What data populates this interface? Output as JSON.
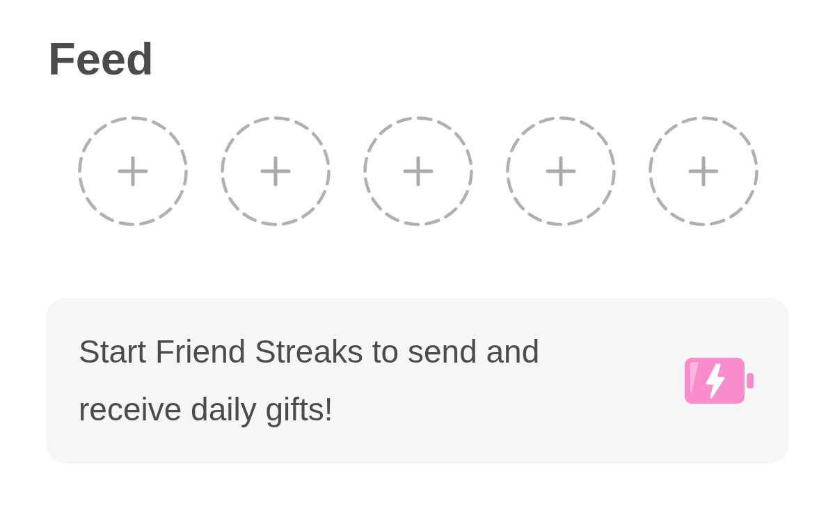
{
  "title": "Feed",
  "slots": [
    {
      "kind": "add"
    },
    {
      "kind": "add"
    },
    {
      "kind": "add"
    },
    {
      "kind": "add"
    },
    {
      "kind": "add"
    }
  ],
  "banner": {
    "text": "Start Friend Streaks to send and receive daily gifts!"
  }
}
